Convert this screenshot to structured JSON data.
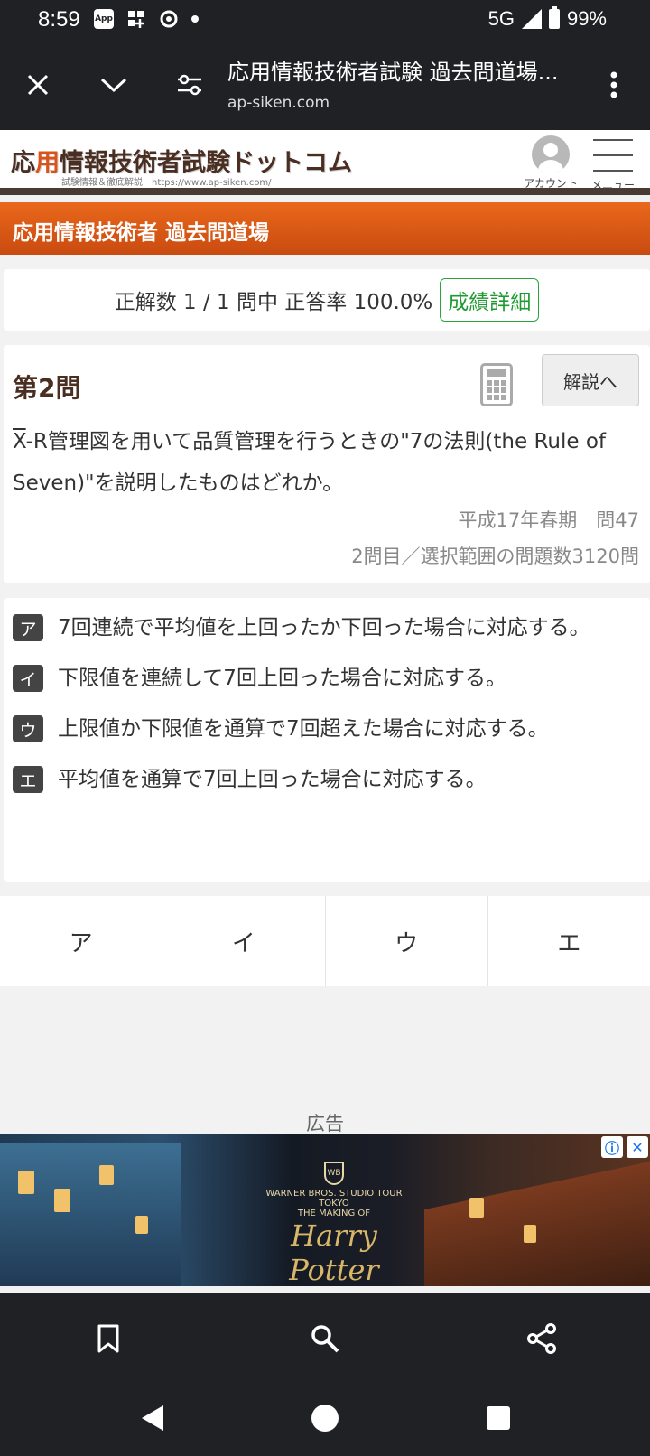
{
  "status_bar": {
    "time": "8:59",
    "app_badge": "App",
    "network": "5G",
    "battery": "99%"
  },
  "tab_bar": {
    "title": "応用情報技術者試験 過去問道場...",
    "url": "ap-siken.com"
  },
  "site": {
    "logo_accent": "用",
    "logo_before": "応",
    "logo_after": "情報技術者試験ドットコム",
    "logo_sub": "試験情報＆徹底解説　https://www.ap-siken.com/",
    "account_label": "アカウント",
    "menu_label": "メニュー"
  },
  "section": {
    "title": "応用情報技術者 過去問道場"
  },
  "score": {
    "text": "正解数 1 / 1 問中 正答率 100.0%",
    "detail_button": "成績詳細"
  },
  "question": {
    "number": "第2問",
    "explain_button": "解説へ",
    "xbar": "X",
    "text": "-R管理図を用いて品質管理を行うときの\"7の法則(the Rule of Seven)\"を説明したものはどれか。",
    "source": "平成17年春期　問47",
    "progress": "2問目／選択範囲の問題数3120問"
  },
  "choices": [
    {
      "tag": "ア",
      "text": "7回連続で平均値を上回ったか下回った場合に対応する。"
    },
    {
      "tag": "イ",
      "text": "下限値を連続して7回上回った場合に対応する。"
    },
    {
      "tag": "ウ",
      "text": "上限値か下限値を通算で7回超えた場合に対応する。"
    },
    {
      "tag": "エ",
      "text": "平均値を通算で7回上回った場合に対応する。"
    }
  ],
  "answers": [
    "ア",
    "イ",
    "ウ",
    "エ"
  ],
  "ad": {
    "label": "広告",
    "brand_line": "WARNER BROS. STUDIO TOUR TOKYO",
    "making_of": "THE MAKING OF",
    "title": "Harry Potter",
    "wb": "WB"
  }
}
